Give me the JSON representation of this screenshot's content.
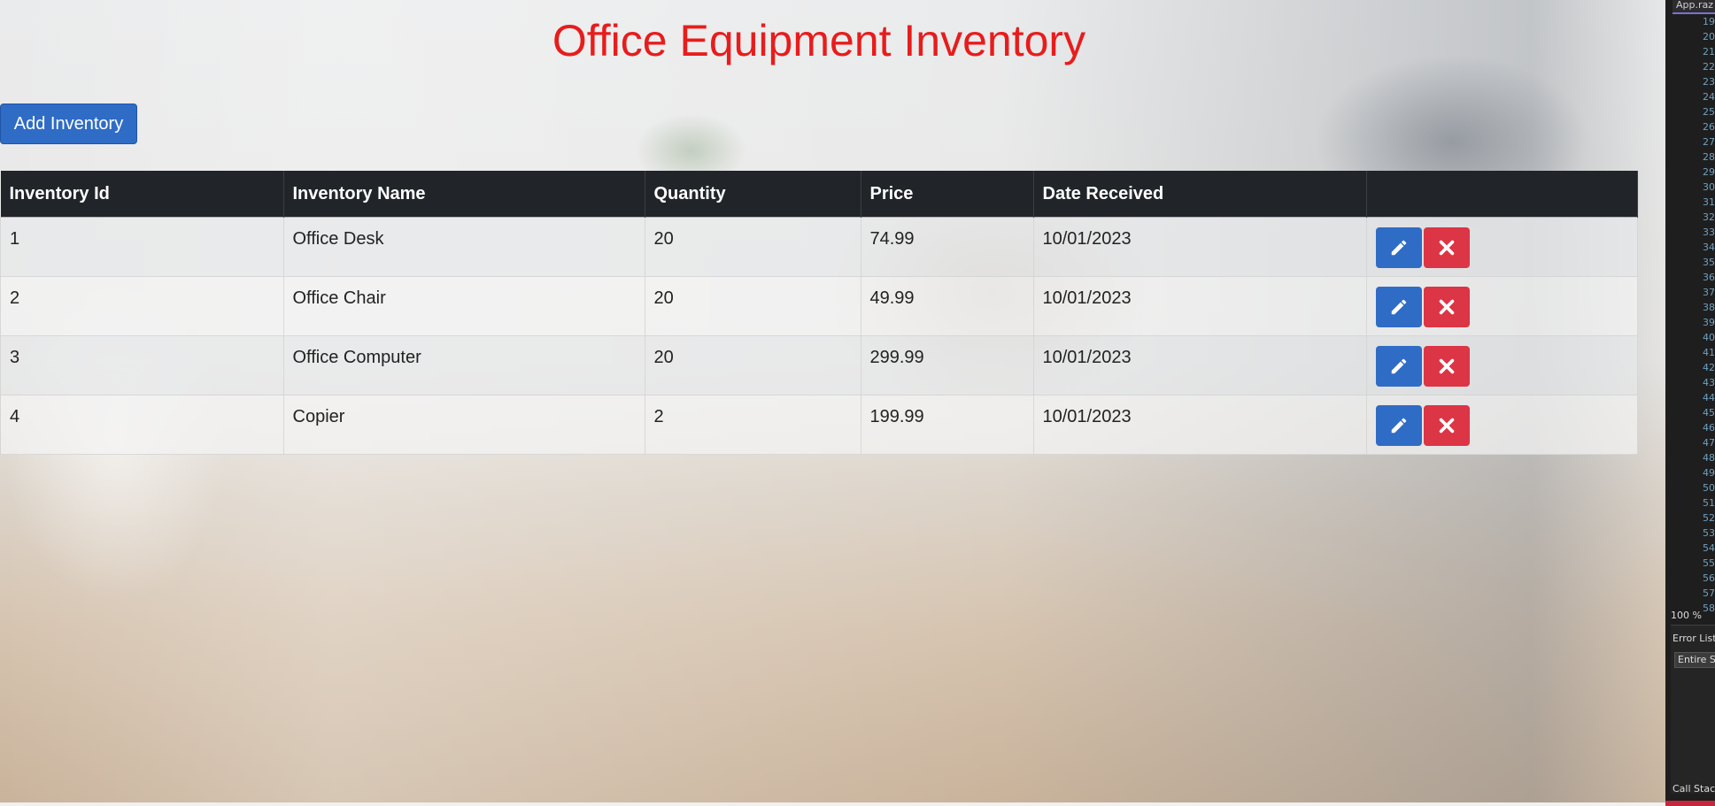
{
  "page": {
    "title": "Office Equipment Inventory",
    "add_button_label": "Add Inventory"
  },
  "table": {
    "headers": [
      "Inventory Id",
      "Inventory Name",
      "Quantity",
      "Price",
      "Date Received",
      ""
    ],
    "rows": [
      {
        "id": "1",
        "name": "Office Desk",
        "quantity": "20",
        "price": "74.99",
        "date": "10/01/2023"
      },
      {
        "id": "2",
        "name": "Office Chair",
        "quantity": "20",
        "price": "49.99",
        "date": "10/01/2023"
      },
      {
        "id": "3",
        "name": "Office Computer",
        "quantity": "20",
        "price": "299.99",
        "date": "10/01/2023"
      },
      {
        "id": "4",
        "name": "Copier",
        "quantity": "2",
        "price": "199.99",
        "date": "10/01/2023"
      }
    ],
    "row_actions": {
      "edit_icon": "pencil-icon",
      "delete_icon": "close-x-icon"
    }
  },
  "ide": {
    "tab_label": "App.raz",
    "line_numbers": [
      "19",
      "20",
      "21",
      "22",
      "23",
      "24",
      "25",
      "26",
      "27",
      "28",
      "29",
      "30",
      "31",
      "32",
      "33",
      "34",
      "35",
      "36",
      "37",
      "38",
      "39",
      "40",
      "41",
      "42",
      "43",
      "44",
      "45",
      "46",
      "47",
      "48",
      "49",
      "50",
      "51",
      "52",
      "53",
      "54",
      "55",
      "56",
      "57",
      "58"
    ],
    "zoom": "100 %",
    "error_list_label": "Error List",
    "scope_label": "Entire S",
    "call_stack_label": "Call Stac"
  },
  "colors": {
    "title": "#e81c1c",
    "primary": "#2f6cc6",
    "danger": "#dc3545",
    "table_header": "#212529"
  }
}
